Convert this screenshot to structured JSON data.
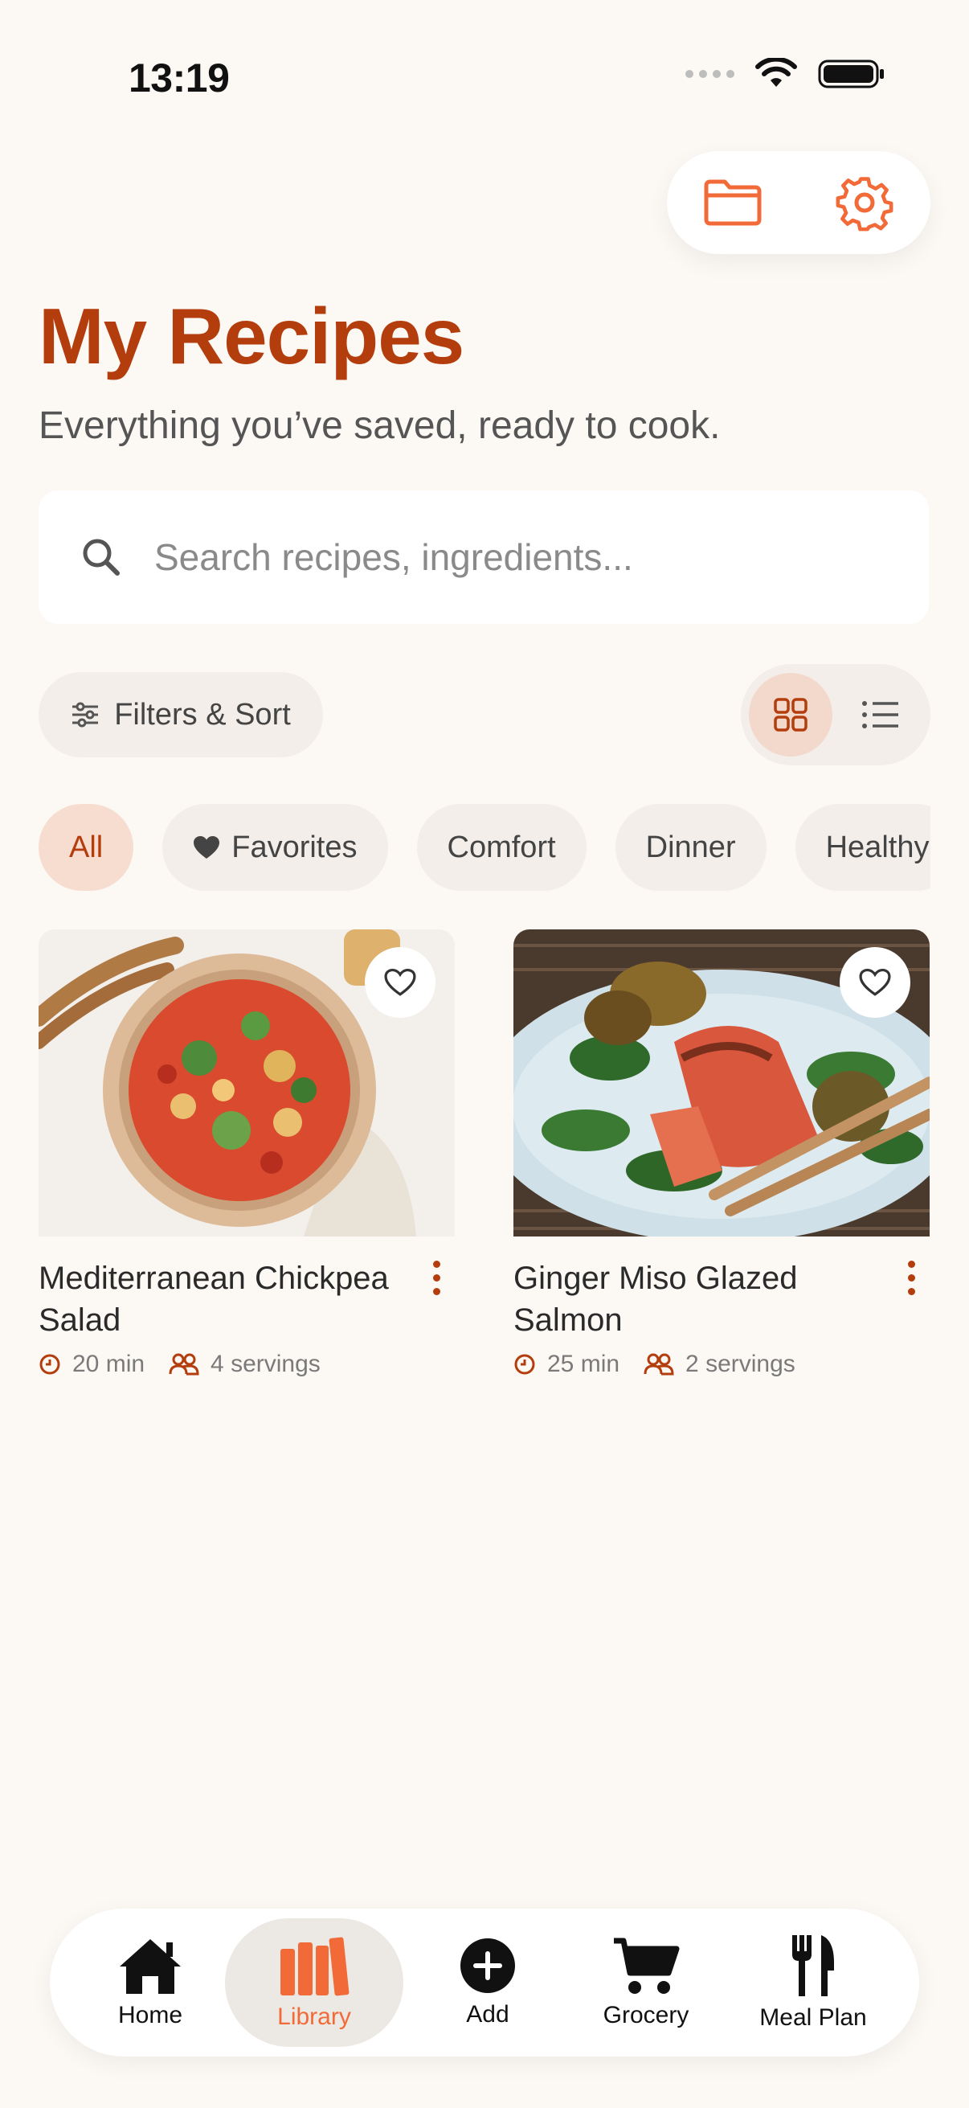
{
  "status_bar": {
    "time": "13:19"
  },
  "header": {
    "title": "My Recipes",
    "subtitle": "Everything you’ve saved, ready to cook."
  },
  "search": {
    "placeholder": "Search recipes, ingredients..."
  },
  "filters": {
    "label": "Filters & Sort"
  },
  "view_toggle": {
    "selected": "grid"
  },
  "chips": [
    {
      "label": "All",
      "active": true
    },
    {
      "label": "Favorites",
      "icon": "heart-icon"
    },
    {
      "label": "Comfort"
    },
    {
      "label": "Dinner"
    },
    {
      "label": "Healthy"
    }
  ],
  "recipes": [
    {
      "title": "Mediterranean Chickpea Salad",
      "time": "20 min",
      "servings": "4 servings"
    },
    {
      "title": "Ginger Miso Glazed Salmon",
      "time": "25 min",
      "servings": "2 servings"
    }
  ],
  "tabbar": [
    {
      "label": "Home",
      "icon": "home-icon"
    },
    {
      "label": "Library",
      "icon": "library-icon",
      "active": true
    },
    {
      "label": "Add",
      "icon": "add-icon"
    },
    {
      "label": "Grocery",
      "icon": "cart-icon"
    },
    {
      "label": "Meal Plan",
      "icon": "utensils-icon"
    }
  ],
  "colors": {
    "accent": "#B43D0D",
    "accent_light": "#F26A38",
    "background": "#FCF8F4"
  }
}
